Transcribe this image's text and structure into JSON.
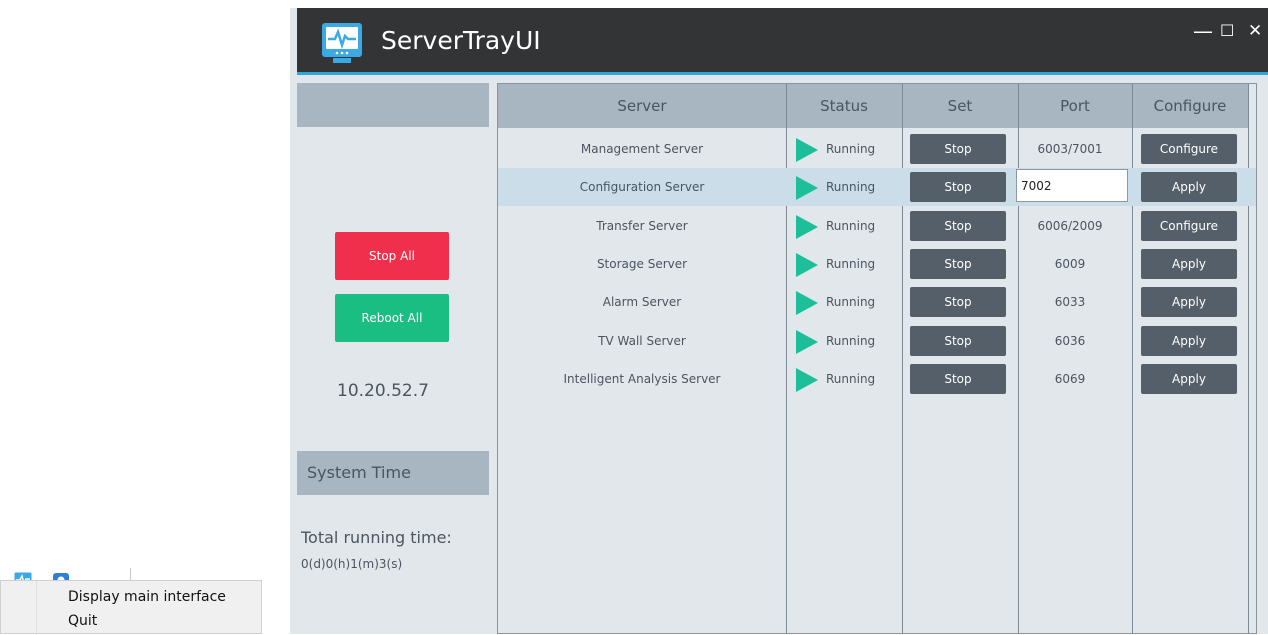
{
  "window": {
    "title": "ServerTrayUI",
    "controls": {
      "minimize": "—",
      "maximize": "☐",
      "close": "✕"
    },
    "colors": {
      "titlebar": "#333435",
      "accent": "#2fa6dc",
      "header": "#a7b6c0"
    }
  },
  "left": {
    "stop_all": "Stop All",
    "reboot_all": "Reboot All",
    "ip": "10.20.52.7",
    "system_time_label": "System Time",
    "total_running_label": "Total running time:",
    "total_running_value": "0(d)0(h)1(m)3(s)",
    "colors": {
      "stop_all": "#ef2f4b",
      "reboot_all": "#1abd82"
    }
  },
  "table": {
    "columns": [
      "Server",
      "Status",
      "Set",
      "Port",
      "Configure"
    ],
    "rows": [
      {
        "name": "Management Server",
        "status": "Running",
        "set": "Stop",
        "port": "6003/7001",
        "configure": "Configure"
      },
      {
        "name": "Configuration Server",
        "status": "Running",
        "set": "Stop",
        "port": "7002",
        "configure": "Apply"
      },
      {
        "name": "Transfer Server",
        "status": "Running",
        "set": "Stop",
        "port": "6006/2009",
        "configure": "Configure"
      },
      {
        "name": "Storage Server",
        "status": "Running",
        "set": "Stop",
        "port": "6009",
        "configure": "Apply"
      },
      {
        "name": "Alarm Server",
        "status": "Running",
        "set": "Stop",
        "port": "6033",
        "configure": "Apply"
      },
      {
        "name": "TV Wall Server",
        "status": "Running",
        "set": "Stop",
        "port": "6036",
        "configure": "Apply"
      },
      {
        "name": "Intelligent Analysis Server",
        "status": "Running",
        "set": "Stop",
        "port": "6069",
        "configure": "Apply"
      }
    ],
    "status_icon": "play-triangle-icon",
    "status_color": "#1dbf9a"
  },
  "context_menu": {
    "items": [
      "Display main interface",
      "Quit"
    ]
  }
}
